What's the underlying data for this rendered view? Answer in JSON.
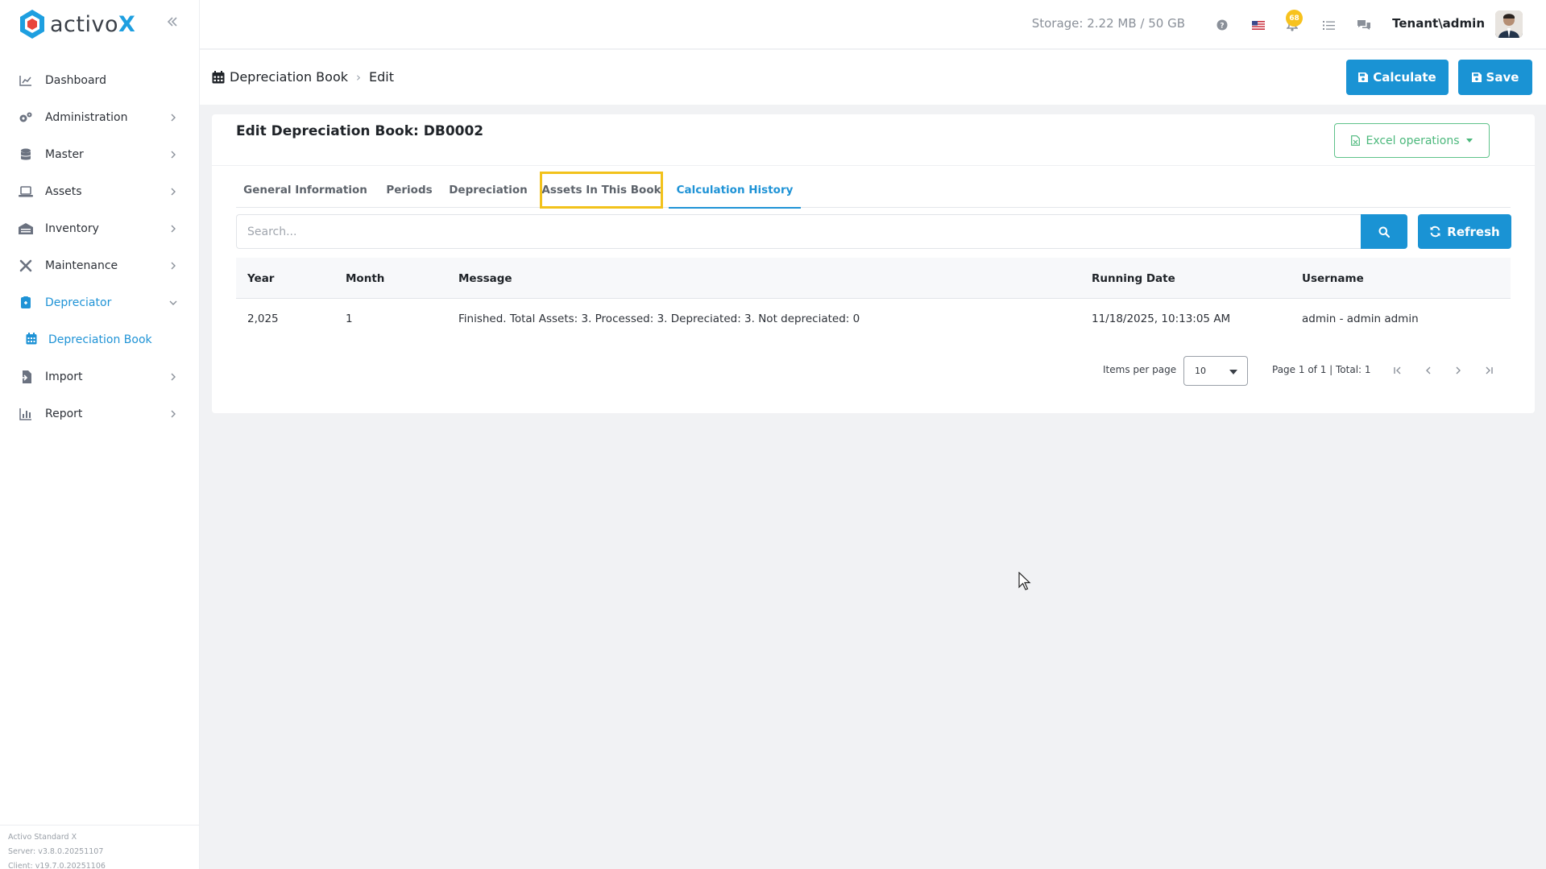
{
  "brand": {
    "name_plain": "activo",
    "name_accent": "X",
    "accent": "#1e9fe0"
  },
  "sidebar": {
    "items": [
      {
        "label": "Dashboard",
        "icon": "chart-line-icon"
      },
      {
        "label": "Administration",
        "icon": "cogs-icon"
      },
      {
        "label": "Master",
        "icon": "database-icon"
      },
      {
        "label": "Assets",
        "icon": "laptop-icon"
      },
      {
        "label": "Inventory",
        "icon": "warehouse-icon"
      },
      {
        "label": "Maintenance",
        "icon": "tools-icon"
      },
      {
        "label": "Depreciator",
        "icon": "calculator-icon"
      },
      {
        "label": "Import",
        "icon": "file-import-icon"
      },
      {
        "label": "Report",
        "icon": "chart-bar-icon"
      }
    ],
    "sub_item": {
      "label": "Depreciation Book",
      "icon": "calendar-icon"
    },
    "footer": [
      "Activo Standard X",
      "Server: v3.8.0.20251107",
      "Client: v19.7.0.20251106"
    ]
  },
  "topbar": {
    "storage": "Storage: 2.22 MB / 50 GB",
    "notification_count": "68",
    "user": "Tenant\\admin"
  },
  "breadcrumb": {
    "root": "Depreciation Book",
    "current": "Edit"
  },
  "actions": {
    "calculate": "Calculate",
    "save": "Save"
  },
  "card": {
    "title": "Edit Depreciation Book: DB0002",
    "excel_label": "Excel operations",
    "tabs": [
      "General Information",
      "Periods",
      "Depreciation",
      "Assets In This Book",
      "Calculation History"
    ],
    "active_tab": "Calculation History"
  },
  "search": {
    "placeholder": "Search...",
    "refresh_label": "Refresh"
  },
  "table": {
    "columns": [
      "Year",
      "Month",
      "Message",
      "Running Date",
      "Username"
    ],
    "rows": [
      [
        "2,025",
        "1",
        "Finished. Total Assets: 3. Processed: 3. Depreciated: 3. Not depreciated: 0",
        "11/18/2025, 10:13:05 AM",
        "admin - admin admin"
      ]
    ]
  },
  "pager": {
    "items_per_page_label": "Items per page",
    "page_size": "10",
    "info": "Page 1 of 1 | Total: 1"
  },
  "colors": {
    "primary": "#1a93d4",
    "success": "#4cb87c",
    "highlight": "#f2c21b"
  }
}
